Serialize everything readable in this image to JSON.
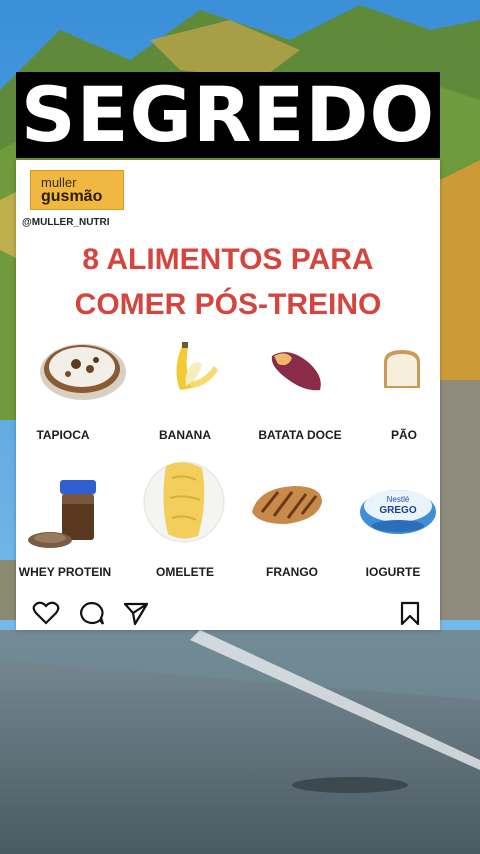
{
  "overlay": {
    "title": "SEGREDO"
  },
  "post": {
    "brand_line1": "muller",
    "brand_line2": "gusmão",
    "handle": "@MULLER_NUTRI",
    "headline_line1": "8 ALIMENTOS PARA",
    "headline_line2": "COMER PÓS-TREINO",
    "foods": [
      {
        "label": "TAPIOCA",
        "icon": "tapioca-icon"
      },
      {
        "label": "BANANA",
        "icon": "banana-icon"
      },
      {
        "label": "BATATA DOCE",
        "icon": "sweet-potato-icon"
      },
      {
        "label": "PÃO",
        "icon": "bread-icon"
      },
      {
        "label": "WHEY PROTEIN",
        "icon": "whey-protein-icon"
      },
      {
        "label": "OMELETE",
        "icon": "omelette-icon"
      },
      {
        "label": "FRANGO",
        "icon": "chicken-icon"
      },
      {
        "label": "IOGURTE",
        "icon": "yogurt-icon"
      }
    ],
    "yogurt_brand": "Nestlé",
    "yogurt_name": "GREGO"
  },
  "actions": {
    "like_icon": "heart-icon",
    "comment_icon": "comment-icon",
    "share_icon": "send-icon",
    "save_icon": "bookmark-icon"
  },
  "colors": {
    "headline": "#d4453d",
    "logo_bg": "#f0b840",
    "title_bar": "#000000"
  }
}
